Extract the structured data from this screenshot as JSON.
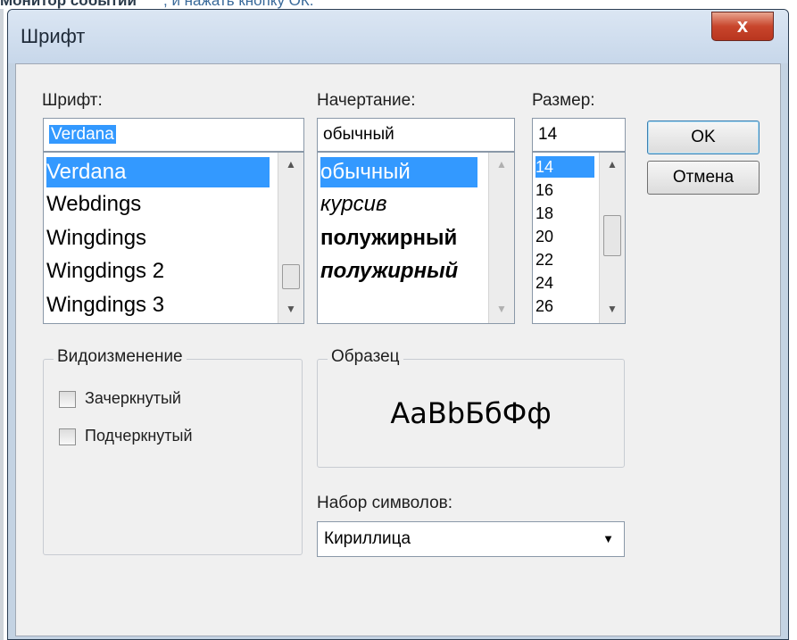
{
  "background_text": {
    "bold": "Монитор событий",
    "rest": ", и нажать кнопку ОК."
  },
  "dialog": {
    "title": "Шрифт",
    "close_label": "x",
    "font": {
      "label": "Шрифт:",
      "value": "Verdana",
      "items": [
        "Verdana",
        "Webdings",
        "Wingdings",
        "Wingdings 2",
        "Wingdings 3"
      ],
      "selected_index": 0
    },
    "style": {
      "label": "Начертание:",
      "value": "обычный",
      "items": [
        "обычный",
        "курсив",
        "полужирный",
        "полужирный"
      ],
      "selected_index": 0
    },
    "size": {
      "label": "Размер:",
      "value": "14",
      "items": [
        "14",
        "16",
        "18",
        "20",
        "22",
        "24",
        "26"
      ],
      "selected_index": 0
    },
    "ok_label": "OK",
    "cancel_label": "Отмена",
    "effects": {
      "legend": "Видоизменение",
      "strikeout_label": "Зачеркнутый",
      "underline_label": "Подчеркнутый"
    },
    "sample": {
      "legend": "Образец",
      "text": "AaBbБбФф"
    },
    "charset": {
      "label": "Набор символов:",
      "value": "Кириллица"
    }
  },
  "icons": {
    "close": "close-icon",
    "scroll_up": "chevron-up-icon",
    "scroll_down": "chevron-down-icon",
    "combo": "dropdown-arrow-icon"
  },
  "colors": {
    "selection": "#3399ff",
    "close_button": "#c8452c",
    "dialog_frame": "#c4d3e3"
  }
}
